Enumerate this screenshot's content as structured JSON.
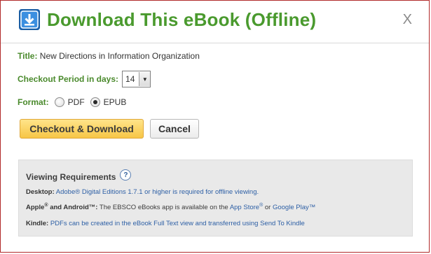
{
  "dialog": {
    "title": "Download This eBook (Offline)",
    "close_label": "X"
  },
  "book": {
    "title_label": "Title:",
    "title_value": "New Directions in Information Organization"
  },
  "checkout": {
    "period_label": "Checkout Period in days:",
    "period_value": "14"
  },
  "format": {
    "label": "Format:",
    "options": [
      {
        "label": "PDF",
        "selected": false
      },
      {
        "label": "EPUB",
        "selected": true
      }
    ]
  },
  "buttons": {
    "primary": "Checkout & Download",
    "secondary": "Cancel"
  },
  "requirements": {
    "title": "Viewing Requirements",
    "help_icon": "?",
    "desktop_label": "Desktop:",
    "desktop_text": "Adobe® Digital Editions 1.7.1 or higher is required for offline viewing.",
    "apple_label_prefix": "Apple",
    "apple_label_mid": " and Android™:",
    "registered": "®",
    "mobile_text": " The EBSCO eBooks app is available on the ",
    "app_store": "App Store",
    "or_text": " or ",
    "google_play": "Google Play™",
    "kindle_label": "Kindle:",
    "kindle_text": "PDFs can be created in the eBook Full Text view and transferred using Send To Kindle"
  },
  "colors": {
    "title_green": "#4a9a2e",
    "label_green": "#4a8a2c",
    "link_blue": "#2d5fa5",
    "primary_button": "#f7c646"
  },
  "icons": {
    "download": "download-icon",
    "close": "close-icon",
    "help": "help-icon",
    "dropdown": "chevron-down-icon"
  }
}
